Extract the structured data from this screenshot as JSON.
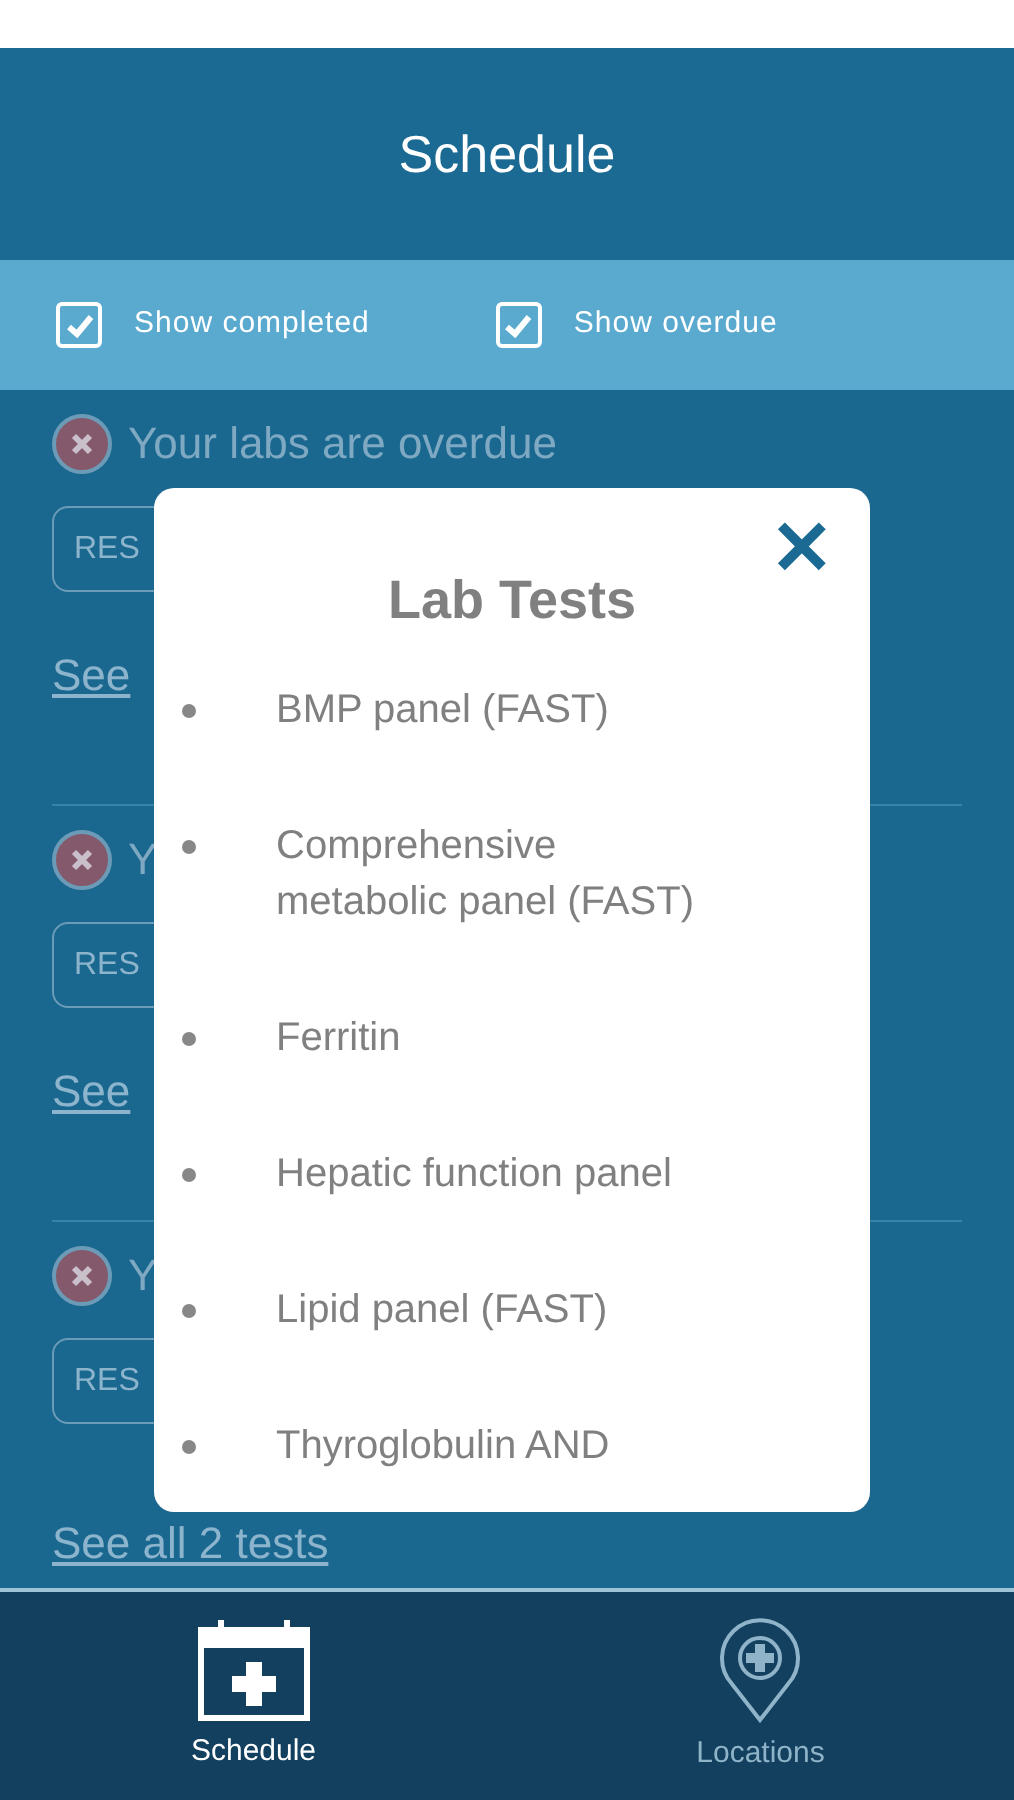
{
  "header": {
    "title": "Schedule"
  },
  "filters": [
    {
      "label": "Show completed",
      "checked": true
    },
    {
      "label": "Show overdue",
      "checked": true
    }
  ],
  "cards": [
    {
      "title": "Your labs are overdue",
      "button": "RES",
      "link": "See"
    },
    {
      "title": "Y",
      "button": "RES",
      "link": "See"
    },
    {
      "title": "Y",
      "button": "RES",
      "link": "See all 2 tests"
    }
  ],
  "modal": {
    "title": "Lab Tests",
    "close": "✕",
    "items": [
      "BMP panel (FAST)",
      "Comprehensive metabolic panel (FAST)",
      "Ferritin",
      "Hepatic function panel",
      "Lipid panel (FAST)",
      "Thyroglobulin AND"
    ]
  },
  "tabs": [
    {
      "label": "Schedule",
      "selected": true,
      "kind": "calendar"
    },
    {
      "label": "Locations",
      "selected": false,
      "kind": "pin"
    }
  ]
}
